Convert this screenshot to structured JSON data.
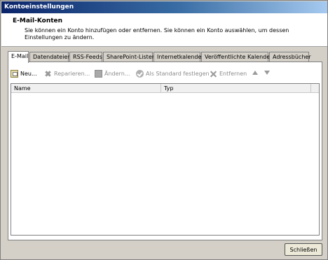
{
  "window": {
    "title": "Kontoeinstellungen"
  },
  "header": {
    "title": "E-Mail-Konten",
    "description": "Sie können ein Konto hinzufügen oder entfernen. Sie können ein Konto auswählen, um dessen Einstellungen zu ändern."
  },
  "tabs": [
    {
      "label": "E-Mail",
      "active": true
    },
    {
      "label": "Datendateien"
    },
    {
      "label": "RSS-Feeds"
    },
    {
      "label": "SharePoint-Listen"
    },
    {
      "label": "Internetkalender"
    },
    {
      "label": "Veröffentlichte Kalender"
    },
    {
      "label": "Adressbücher"
    }
  ],
  "toolbar": {
    "new": "Neu...",
    "repair": "Reparieren...",
    "change": "Ändern...",
    "set_default": "Als Standard festlegen",
    "remove": "Entfernen"
  },
  "list": {
    "columns": [
      "Name",
      "Typ"
    ]
  },
  "footer": {
    "close": "Schließen"
  }
}
